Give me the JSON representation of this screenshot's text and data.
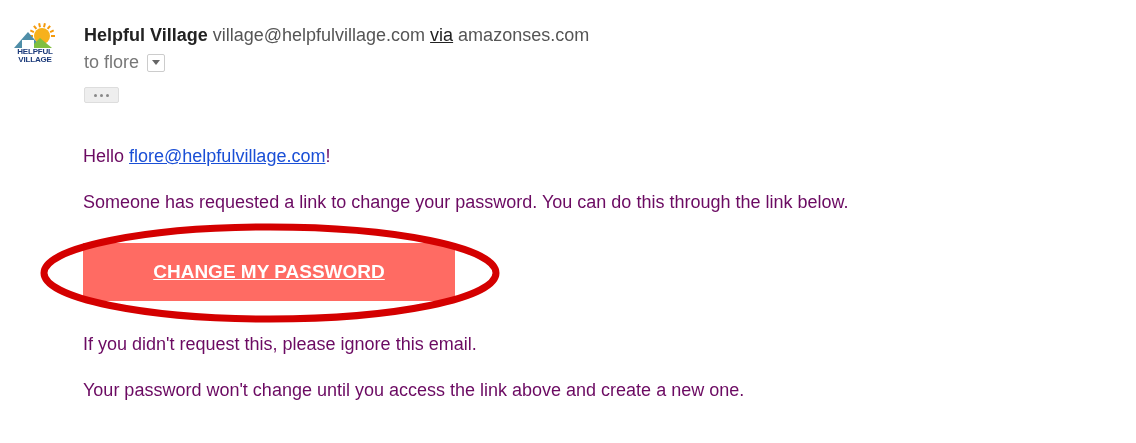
{
  "sender": {
    "logo_lines": [
      "HELPFUL",
      "VILLAGE"
    ],
    "name": "Helpful Village",
    "address": "village@helpfulvillage.com",
    "via": "via",
    "relay": "amazonses.com",
    "recipient": "to flore",
    "details_expanded": false
  },
  "body": {
    "greeting": "Hello",
    "email_link": "flore@helpfulvillage.com",
    "exclamation": "!",
    "intro": "Someone has requested a link to change your password. You can do this through the link below.",
    "button": "CHANGE MY PASSWORD",
    "paragraphs": [
      "If you didn't request this, please ignore this email.",
      "Your password won't change until you access the link above and create a new one."
    ]
  },
  "annotation": {
    "kind": "ellipse",
    "color": "#d40000"
  }
}
